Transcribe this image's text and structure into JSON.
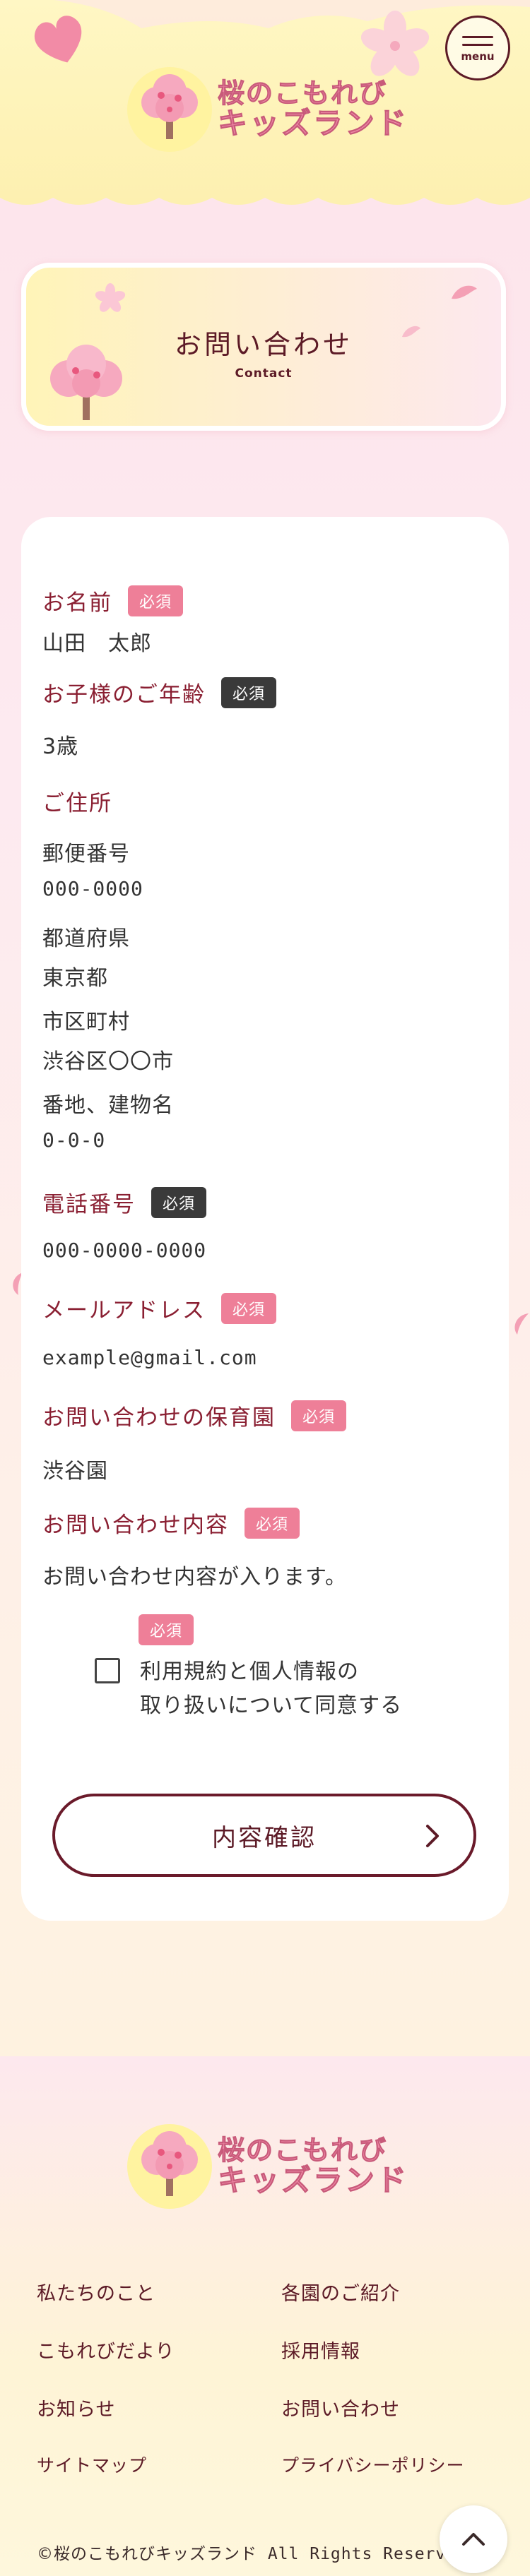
{
  "header": {
    "logo": {
      "line1": "桜のこもれび",
      "line2": "キッズランド"
    },
    "menu_label": "menu"
  },
  "page_title": {
    "heading": "お問い合わせ",
    "sub": "Contact"
  },
  "form": {
    "required_label": "必須",
    "name": {
      "label": "お名前",
      "value": "山田　太郎"
    },
    "child_age": {
      "label": "お子様のご年齢",
      "value": "3歳"
    },
    "address": {
      "label": "ご住所",
      "postal_label": "郵便番号",
      "postal_value": "000-0000",
      "pref_label": "都道府県",
      "pref_value": "東京都",
      "city_label": "市区町村",
      "city_value": "渋谷区〇〇市",
      "street_label": "番地、建物名",
      "street_value": "0-0-0"
    },
    "phone": {
      "label": "電話番号",
      "value": "000-0000-0000"
    },
    "email": {
      "label": "メールアドレス",
      "value": "example@gmail.com"
    },
    "nursery": {
      "label": "お問い合わせの保育園",
      "value": "渋谷園"
    },
    "content": {
      "label": "お問い合わせ内容",
      "value": "お問い合わせ内容が入ります。"
    },
    "agree": {
      "line1": "利用規約と個人情報の",
      "line2": "取り扱いについて同意する",
      "checked": false
    },
    "confirm_label": "内容確認"
  },
  "footer": {
    "logo": {
      "line1": "桜のこもれび",
      "line2": "キッズランド"
    },
    "links": [
      "私たちのこと",
      "各園のご紹介",
      "こもれびだより",
      "採用情報",
      "お知らせ",
      "お問い合わせ",
      "サイトマップ",
      "プライバシーポリシー"
    ],
    "copyright_brand": "©桜のこもれびキッズランド",
    "copyright_rights": " All Rights Reserved."
  },
  "colors": {
    "accent": "#8a1f32",
    "badge_required": "#ee7f98",
    "badge_required_dark": "#3a3a3a",
    "logo_pink": "#f08aa7"
  },
  "icons": {
    "menu": "hamburger-icon",
    "confirm": "chevron-right-icon",
    "to_top": "chevron-up-icon",
    "logo": "cherry-tree-icon"
  }
}
